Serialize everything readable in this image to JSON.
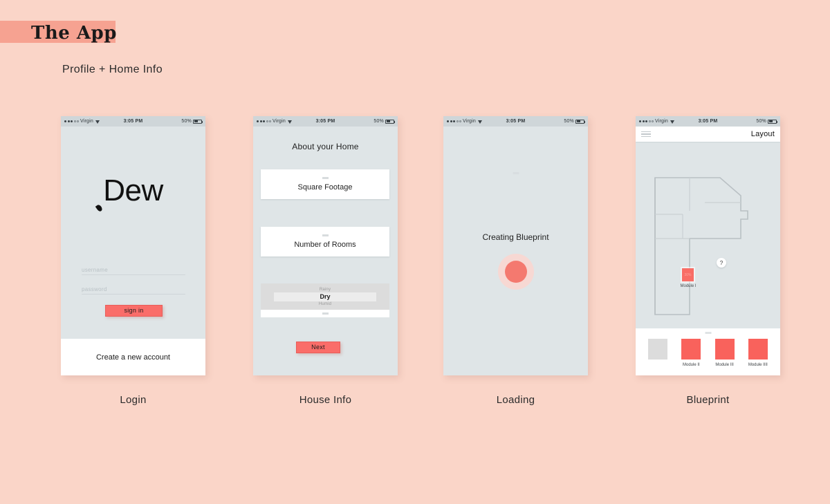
{
  "header": {
    "title": "The App",
    "subtitle": "Profile + Home Info",
    "highlight_color": "#f6a291",
    "background_color": "#fad5c8"
  },
  "status_bar": {
    "carrier": "Virgin",
    "time": "3:05 PM",
    "battery": "50%",
    "signal_filled_dots": 3,
    "signal_hollow_dots": 2
  },
  "theme": {
    "accent": "#fa6d69",
    "screen_bg": "#dfe5e7",
    "panel": "#ffffff"
  },
  "screens": [
    {
      "caption": "Login",
      "logo": "Dew",
      "username_placeholder": "username",
      "password_placeholder": "password",
      "signin_label": "sign in",
      "create_account_label": "Create a new account"
    },
    {
      "caption": "House Info",
      "title": "About your Home",
      "cards": [
        {
          "label": "Square Footage"
        },
        {
          "label": "Number of Rooms"
        }
      ],
      "picker": {
        "above": "Rainy",
        "selected": "Dry",
        "below": "Humid"
      },
      "next_label": "Next"
    },
    {
      "caption": "Loading",
      "status_text": "Creating Blueprint"
    },
    {
      "caption": "Blueprint",
      "nav_title": "Layout",
      "menu_icon": "hamburger-icon",
      "plan_module": {
        "percent": "30%",
        "label": "Module I"
      },
      "help_marker": "?",
      "tray": [
        {
          "label": "",
          "color": "#dcdcdc"
        },
        {
          "label": "Module II",
          "color": "#f9625c"
        },
        {
          "label": "Module III",
          "color": "#f9625c"
        },
        {
          "label": "Module IIII",
          "color": "#f9625c"
        }
      ]
    }
  ]
}
